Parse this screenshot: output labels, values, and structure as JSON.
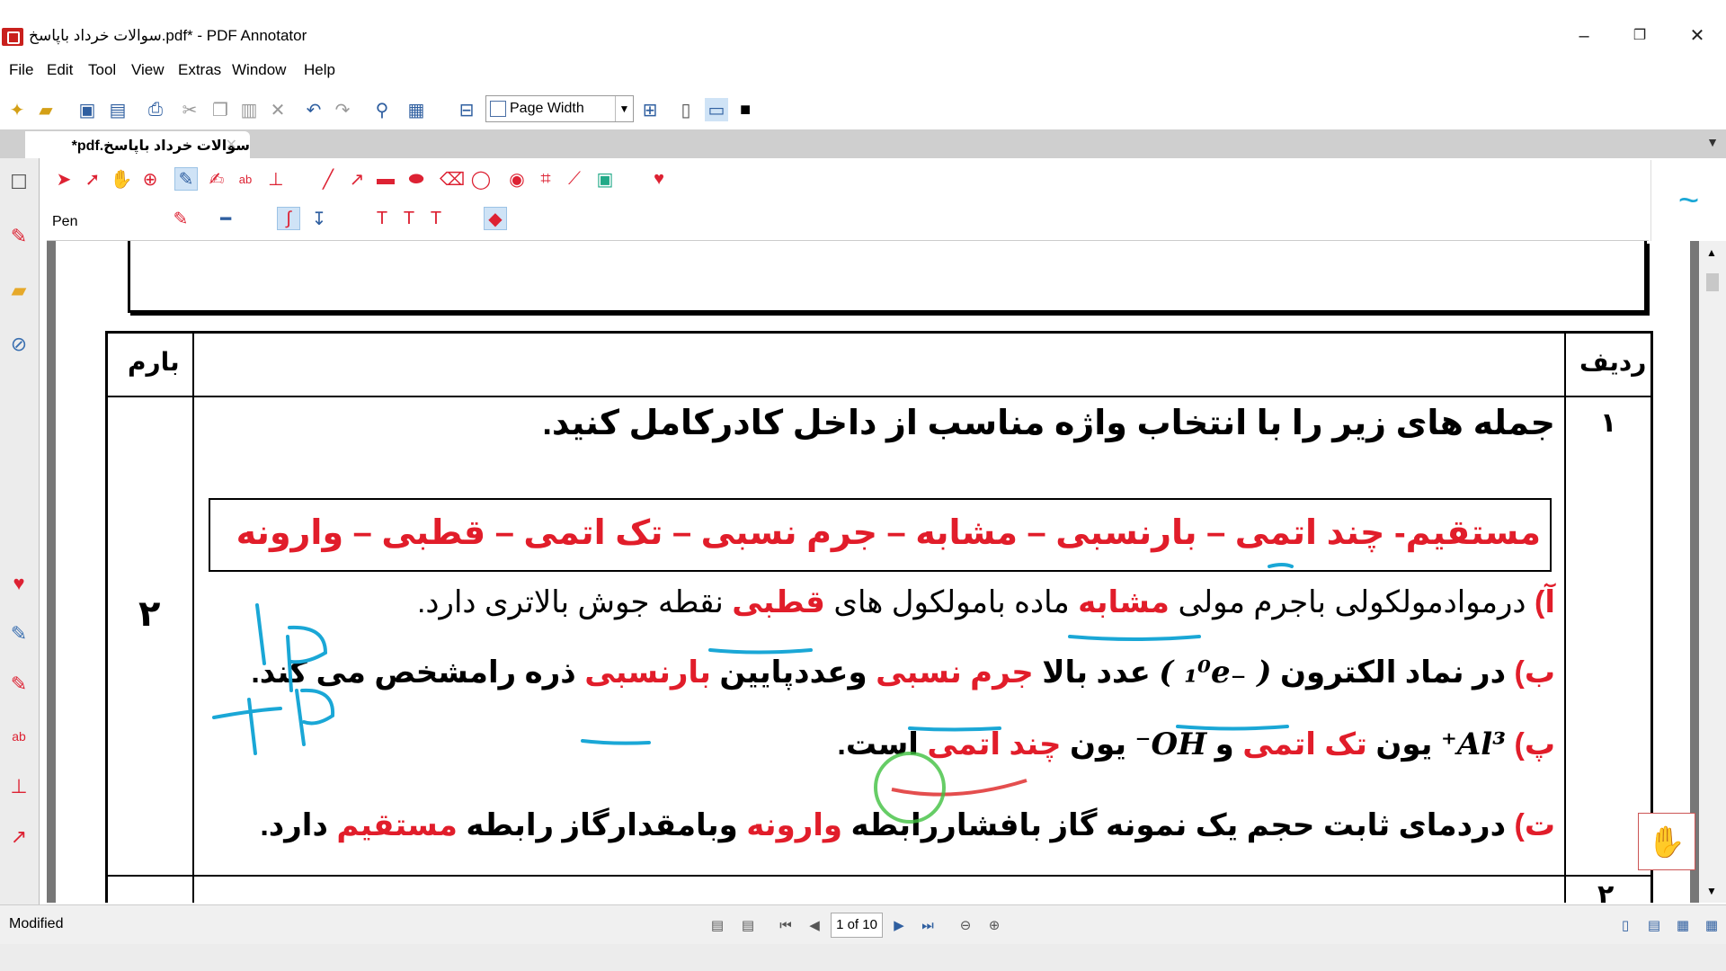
{
  "window": {
    "title": "سوالات خرداد باپاسخ.pdf* - PDF Annotator",
    "minimize": "–",
    "maximize": "❐",
    "close": "✕"
  },
  "menu": {
    "items": [
      "File",
      "Edit",
      "Tool",
      "View",
      "Extras",
      "Window",
      "Help"
    ]
  },
  "toolbar": {
    "zoom_value": "Page Width"
  },
  "tab": {
    "name": "سوالات خرداد باپاسخ.pdf*",
    "close": "✕"
  },
  "tool_panel": {
    "current_tool": "Pen"
  },
  "document": {
    "header_radif": "ردیف",
    "header_barem": "بارم",
    "row1_num": "۱",
    "row1_score": "۲",
    "instruction": "جمله های زیر را با انتخاب واژه  مناسب از داخل کادرکامل کنید.",
    "word_box": "مستقیم-  چند اتمی – بارنسبی – مشابه  –  جرم نسبی – تک اتمی – قطبی – وارونه",
    "line_a": {
      "prefix": "آ)",
      "t1": "درموادمولکولی باجرم مولی",
      "w1": "مشابه",
      "t2": "ماده بامولکول های",
      "w2": "قطبی",
      "t3": "نقطه جوش بالاتری دارد."
    },
    "line_b": {
      "prefix": "ب)",
      "t1": "در نماد الکترون",
      "formula": "( ₋₁⁰e )",
      "t2": "عدد بالا",
      "w1": "جرم نسبی",
      "t3": "وعددپایین",
      "w2": "بارنسبی",
      "t4": "ذره رامشخص می کند."
    },
    "line_p": {
      "prefix": "پ)",
      "f1": "Al³⁺",
      "t1": "یون",
      "w1": "تک اتمی",
      "t2": "و",
      "f2": "OH⁻",
      "t3": "یون",
      "w2": "چند اتمی",
      "t4": "است."
    },
    "line_t": {
      "prefix": "ت)",
      "t1": "دردمای ثابت حجم یک نمونه گاز بافشاررابطه",
      "w1": "وارونه",
      "t2": "وبامقدارگاز رابطه",
      "w2": "مستقیم",
      "t3": "دارد."
    },
    "row2_num": "۲"
  },
  "status": {
    "text": "Modified",
    "page_indicator": "1 of 10"
  },
  "colors": {
    "accent": "#e11d2a",
    "pen": "#1aa7d6"
  }
}
